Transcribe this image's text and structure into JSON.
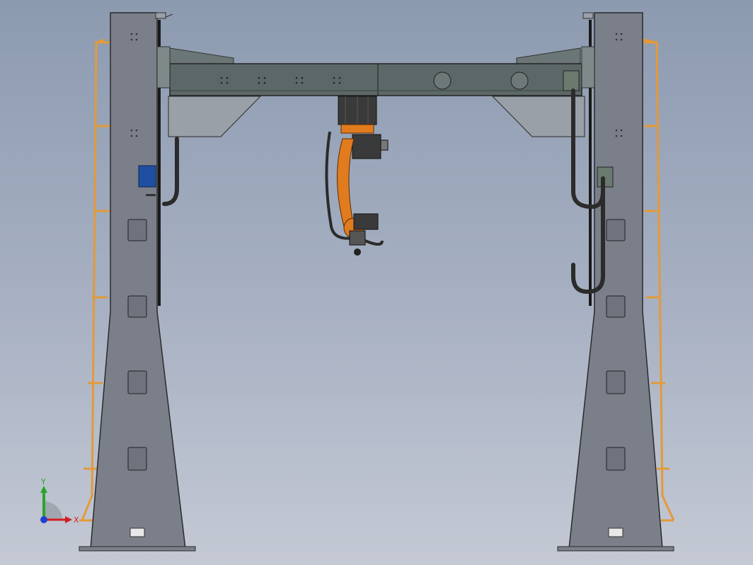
{
  "scene": {
    "background_top": "#8c9ab0",
    "background_bottom": "#c4c9d4",
    "column_color": "#7b7f8a",
    "beam_color": "#5c6868",
    "robot_color": "#e07b1e",
    "ladder_color": "#e39a3a",
    "hose_color": "#2b2b2b",
    "panel_color": "#1f4fa0"
  },
  "triad": {
    "x_label": "X",
    "y_label": "Y",
    "x_color": "#d21f1f",
    "y_color": "#2aa52a",
    "z_color": "#1f3fd2"
  }
}
